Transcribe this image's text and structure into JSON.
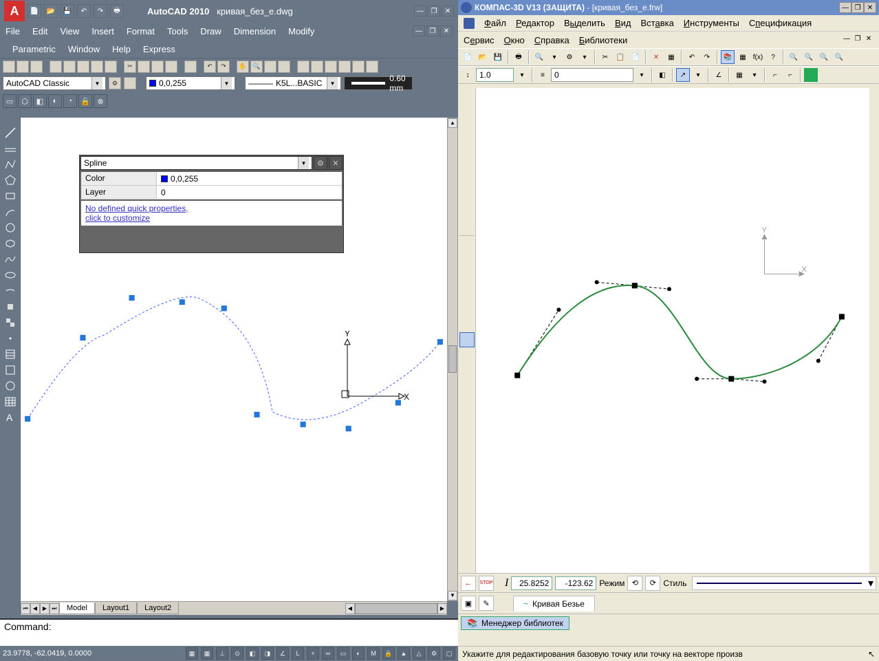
{
  "autocad": {
    "app_name": "AutoCAD 2010",
    "doc_name": "кривая_без_e.dwg",
    "menus1": [
      "File",
      "Edit",
      "View",
      "Insert",
      "Format",
      "Tools",
      "Draw",
      "Dimension",
      "Modify"
    ],
    "menus2": [
      "Parametric",
      "Window",
      "Help",
      "Express"
    ],
    "workspace": "AutoCAD Classic",
    "color_txt": "0,0,255",
    "linetype": "K5L...BASIC",
    "lineweight": "0.60 mm",
    "qprops": {
      "type": "Spline",
      "rows": [
        {
          "label": "Color",
          "value": "0,0,255",
          "swatch": true
        },
        {
          "label": "Layer",
          "value": "0",
          "swatch": false
        }
      ],
      "link1": "No defined quick properties,",
      "link2": "click to customize"
    },
    "axis_x": "X",
    "axis_y": "Y",
    "tabs": [
      "Model",
      "Layout1",
      "Layout2"
    ],
    "cmd": "Command:",
    "status_coords": "23.9778, -62.0419, 0.0000"
  },
  "kompas": {
    "app_name": "КОМПАС-3D V13 (ЗАЩИТА)",
    "doc_name": "[кривая_без_e.frw]",
    "menus1": [
      "Файл",
      "Редактор",
      "Выделить",
      "Вид",
      "Вставка",
      "Инструменты",
      "Спецификация"
    ],
    "menus2": [
      "Сервис",
      "Окно",
      "Справка",
      "Библиотеки"
    ],
    "scale_val": "1.0",
    "layer_val": "0",
    "axis_x": "X",
    "axis_y": "Y",
    "bp": {
      "coord_x": "25.8252",
      "coord_y": "-123.62",
      "mode": "Режим",
      "style": "Стиль",
      "tab_label": "Кривая Безье"
    },
    "lib_manager": "Менеджер библиотек",
    "status": "Укажите для редактирования базовую точку или точку на векторе произв"
  }
}
